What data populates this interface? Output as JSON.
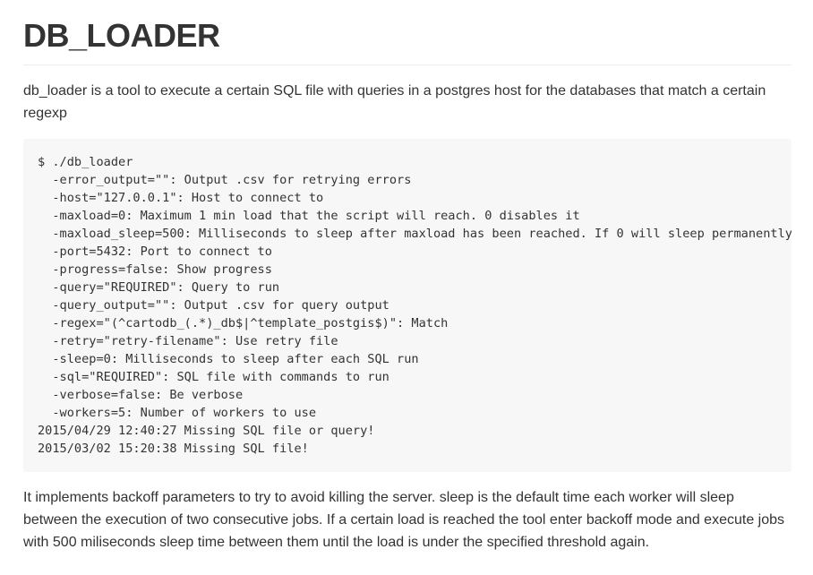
{
  "title": "DB_LOADER",
  "intro": "db_loader is a tool to execute a certain SQL file with queries in a postgres host for the databases that match a certain regexp",
  "code_lines": [
    "$ ./db_loader",
    "  -error_output=\"\": Output .csv for retrying errors",
    "  -host=\"127.0.0.1\": Host to connect to",
    "  -maxload=0: Maximum 1 min load that the script will reach. 0 disables it",
    "  -maxload_sleep=500: Milliseconds to sleep after maxload has been reached. If 0 will sleep permanently",
    "  -port=5432: Port to connect to",
    "  -progress=false: Show progress",
    "  -query=\"REQUIRED\": Query to run",
    "  -query_output=\"\": Output .csv for query output",
    "  -regex=\"(^cartodb_(.*)_db$|^template_postgis$)\": Match",
    "  -retry=\"retry-filename\": Use retry file",
    "  -sleep=0: Milliseconds to sleep after each SQL run",
    "  -sql=\"REQUIRED\": SQL file with commands to run",
    "  -verbose=false: Be verbose",
    "  -workers=5: Number of workers to use",
    "2015/04/29 12:40:27 Missing SQL file or query!",
    "2015/03/02 15:20:38 Missing SQL file!"
  ],
  "outro": "It implements backoff parameters to try to avoid killing the server. sleep is the default time each worker will sleep between the execution of two consecutive jobs. If a certain load is reached the tool enter backoff mode and execute jobs with 500 miliseconds sleep time between them until the load is under the specified threshold again."
}
